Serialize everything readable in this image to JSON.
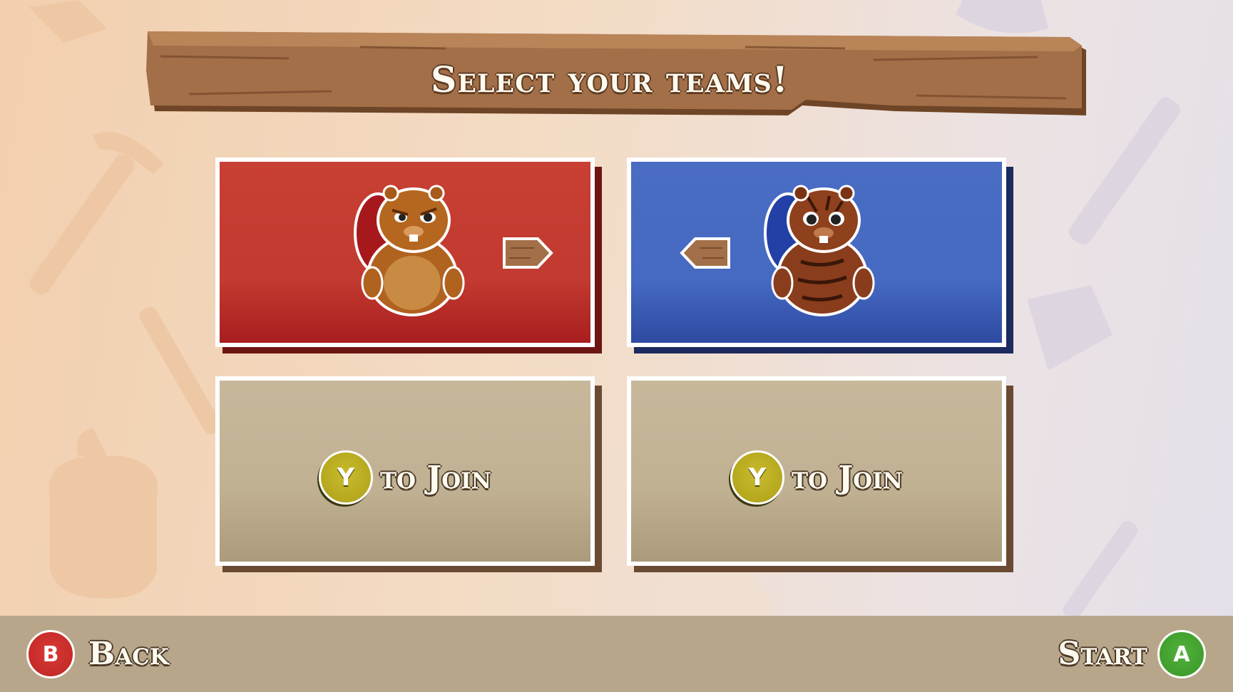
{
  "title": "Select your teams!",
  "teams": [
    {
      "name": "red",
      "color": "#c23a30"
    },
    {
      "name": "blue",
      "color": "#466ac2"
    }
  ],
  "join_slots": [
    {
      "button": "Y",
      "label": "to Join"
    },
    {
      "button": "Y",
      "label": "to Join"
    }
  ],
  "footer": {
    "back_button": "B",
    "back_label": "Back",
    "start_label": "Start",
    "start_button": "A"
  },
  "colors": {
    "red_team": "#c23a30",
    "blue_team": "#466ac2",
    "empty_slot": "#c1b193",
    "y_button": "#b5a81e",
    "b_button": "#c42a27",
    "a_button": "#3f9d2c",
    "wood": "#9c6a45"
  }
}
